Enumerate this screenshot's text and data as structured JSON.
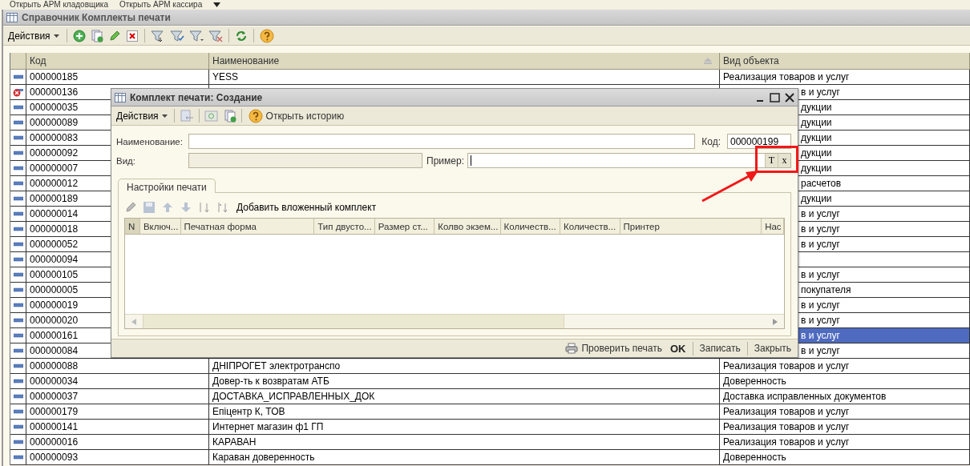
{
  "top_bar": {
    "links": [
      "Открыть АРМ кладовщика",
      "Открыть АРМ кассира"
    ]
  },
  "main_window": {
    "title": "Справочник Комплекты печати",
    "toolbar": {
      "menu": "Действия"
    },
    "table": {
      "columns": [
        "Код",
        "Наименование",
        "Вид объекта"
      ],
      "rows": [
        {
          "kind": "full",
          "marked_for_deletion": false,
          "selected": false,
          "code": "000000185",
          "name": "YESS",
          "object_type": "Реализация товаров и услуг"
        },
        {
          "kind": "covered",
          "marked_for_deletion": true,
          "selected": false,
          "code": "000000136",
          "object_type": "в и услуг"
        },
        {
          "kind": "covered",
          "marked_for_deletion": false,
          "selected": false,
          "code": "000000035",
          "object_type": "дукции"
        },
        {
          "kind": "covered",
          "marked_for_deletion": false,
          "selected": false,
          "code": "000000089",
          "object_type": "дукции"
        },
        {
          "kind": "covered",
          "marked_for_deletion": false,
          "selected": false,
          "code": "000000083",
          "object_type": "дукции"
        },
        {
          "kind": "covered",
          "marked_for_deletion": false,
          "selected": false,
          "code": "000000092",
          "object_type": "дукции"
        },
        {
          "kind": "covered",
          "marked_for_deletion": false,
          "selected": false,
          "code": "000000007",
          "object_type": "дукции"
        },
        {
          "kind": "covered",
          "marked_for_deletion": false,
          "selected": false,
          "code": "000000012",
          "object_type": "расчетов"
        },
        {
          "kind": "covered",
          "marked_for_deletion": false,
          "selected": false,
          "code": "000000189",
          "object_type": "дукции"
        },
        {
          "kind": "covered",
          "marked_for_deletion": false,
          "selected": false,
          "code": "000000014",
          "object_type": "в и услуг"
        },
        {
          "kind": "covered",
          "marked_for_deletion": false,
          "selected": false,
          "code": "000000018",
          "object_type": "в и услуг"
        },
        {
          "kind": "covered",
          "marked_for_deletion": false,
          "selected": false,
          "code": "000000052",
          "object_type": "в и услуг"
        },
        {
          "kind": "covered",
          "marked_for_deletion": false,
          "selected": false,
          "code": "000000094"
        },
        {
          "kind": "covered",
          "marked_for_deletion": false,
          "selected": false,
          "code": "000000105",
          "object_type": "в и услуг"
        },
        {
          "kind": "covered",
          "marked_for_deletion": false,
          "selected": false,
          "code": "000000005",
          "object_type": "покупателя"
        },
        {
          "kind": "covered",
          "marked_for_deletion": false,
          "selected": false,
          "code": "000000019",
          "object_type": "в и услуг"
        },
        {
          "kind": "covered",
          "marked_for_deletion": false,
          "selected": false,
          "code": "000000020",
          "object_type": "в и услуг"
        },
        {
          "kind": "covered",
          "marked_for_deletion": false,
          "selected": true,
          "code": "000000161",
          "object_type": "в и услуг"
        },
        {
          "kind": "covered",
          "marked_for_deletion": false,
          "selected": false,
          "code": "000000084",
          "object_type": "в и услуг"
        },
        {
          "kind": "full",
          "marked_for_deletion": false,
          "selected": false,
          "code": "000000088",
          "name": "ДНІПРОГЕТ электротранспо",
          "object_type": "Реализация товаров и услуг"
        },
        {
          "kind": "full",
          "marked_for_deletion": false,
          "selected": false,
          "code": "000000034",
          "name": "Довер-ть к возвратам АТБ",
          "object_type": "Доверенность"
        },
        {
          "kind": "full",
          "marked_for_deletion": false,
          "selected": false,
          "code": "000000037",
          "name": "ДОСТАВКА_ИСПРАВЛЕННЫХ_ДОК",
          "object_type": "Доставка исправленных документов"
        },
        {
          "kind": "full",
          "marked_for_deletion": false,
          "selected": false,
          "code": "000000179",
          "name": "Епіцентр К, ТОВ",
          "object_type": "Реализация товаров и услуг"
        },
        {
          "kind": "full",
          "marked_for_deletion": false,
          "selected": false,
          "code": "000000141",
          "name": "Интернет магазин ф1 ГП",
          "object_type": "Реализация товаров и услуг"
        },
        {
          "kind": "full",
          "marked_for_deletion": false,
          "selected": false,
          "code": "000000016",
          "name": "КАРАВАН",
          "object_type": "Реализация товаров и услуг"
        },
        {
          "kind": "full",
          "marked_for_deletion": false,
          "selected": false,
          "code": "000000093",
          "name": "Караван доверенность",
          "object_type": "Доверенность"
        }
      ]
    }
  },
  "dialog": {
    "title": "Комплект печати: Создание",
    "toolbar": {
      "menu": "Действия",
      "history_button": "Открыть историю"
    },
    "fields": {
      "name": {
        "label": "Наименование:",
        "disabled": false
      },
      "code": {
        "label": "Код:",
        "value": "000000199"
      },
      "kind": {
        "label": "Вид:",
        "disabled": true
      },
      "example": {
        "label": "Пример:",
        "focused": true,
        "buttons": [
          "T",
          "x"
        ]
      }
    },
    "tabs": [
      {
        "label": "Настройки печати",
        "selected": true
      }
    ],
    "tab_toolbar": {
      "add_nested_button": "Добавить вложенный комплект"
    },
    "grid": {
      "columns": [
        "N",
        "Включ...",
        "Печатная форма",
        "Тип двусто...",
        "Размер ст...",
        "Колво экзем...",
        "Количеств...",
        "Количеств...",
        "Принтер",
        "Нас"
      ]
    },
    "footer": {
      "buttons": [
        {
          "kind": "print",
          "label": "Проверить печать"
        },
        {
          "kind": "default",
          "label": "OK"
        },
        {
          "kind": "plain",
          "label": "Записать"
        },
        {
          "kind": "plain",
          "label": "Закрыть"
        }
      ]
    }
  }
}
